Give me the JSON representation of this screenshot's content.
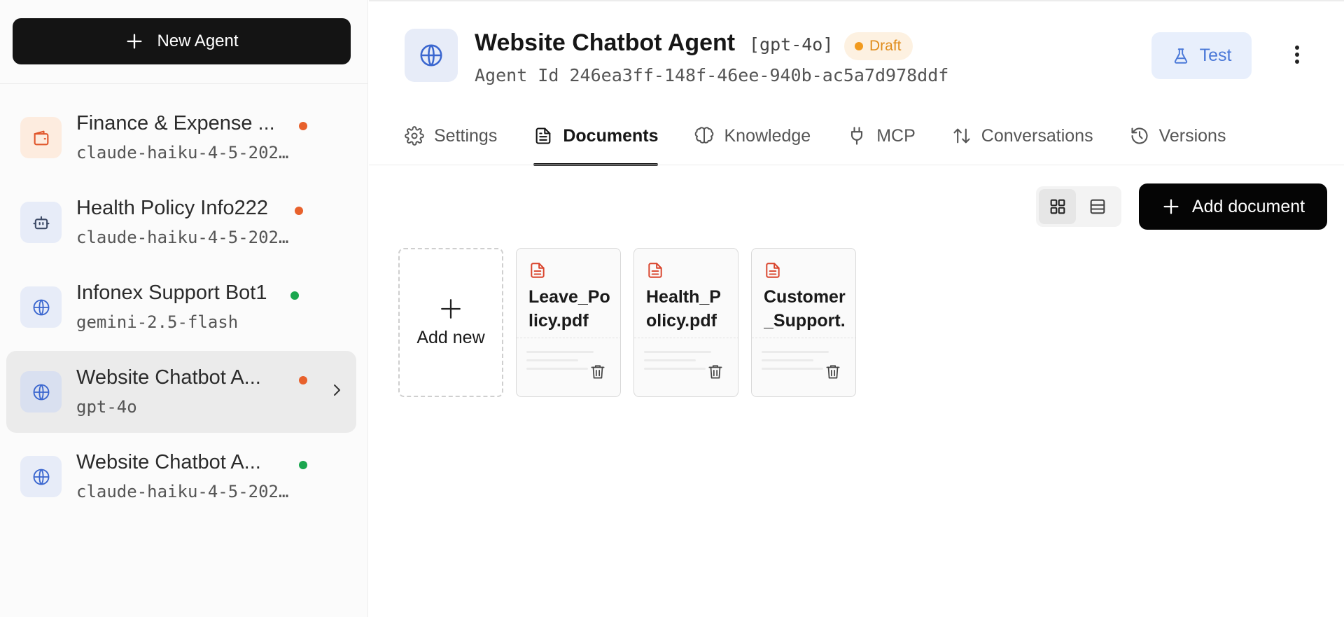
{
  "sidebar": {
    "new_agent_label": "New Agent",
    "agents": [
      {
        "name": "Finance & Expense ...",
        "model": "claude-haiku-4-5-202…",
        "status_color": "#e8612c",
        "icon": "wallet-icon"
      },
      {
        "name": "Health Policy Info222",
        "model": "claude-haiku-4-5-202…",
        "status_color": "#e8612c",
        "icon": "bot-icon"
      },
      {
        "name": "Infonex Support Bot1",
        "model": "gemini-2.5-flash",
        "status_color": "#1aa64e",
        "icon": "globe-icon"
      },
      {
        "name": "Website Chatbot A...",
        "model": "gpt-4o",
        "status_color": "#e8612c",
        "icon": "globe-icon",
        "selected": true
      },
      {
        "name": "Website Chatbot A...",
        "model": "claude-haiku-4-5-202…",
        "status_color": "#1aa64e",
        "icon": "globe-icon"
      }
    ]
  },
  "header": {
    "title": "Website Chatbot Agent",
    "model_tag": "[gpt-4o]",
    "status_badge": "Draft",
    "agent_id_label": "Agent Id",
    "agent_id": "246ea3ff-148f-46ee-940b-ac5a7d978ddf",
    "test_label": "Test"
  },
  "tabs": [
    {
      "label": "Settings",
      "icon": "gear-icon"
    },
    {
      "label": "Documents",
      "icon": "document-icon",
      "active": true
    },
    {
      "label": "Knowledge",
      "icon": "brain-icon"
    },
    {
      "label": "MCP",
      "icon": "plug-icon"
    },
    {
      "label": "Conversations",
      "icon": "arrows-updown-icon"
    },
    {
      "label": "Versions",
      "icon": "history-icon"
    }
  ],
  "documents": {
    "add_document_label": "Add document",
    "add_new_label": "Add new",
    "files": [
      {
        "name": "Leave_Policy.pdf"
      },
      {
        "name": "Health_Policy.pdf"
      },
      {
        "name": "Customer_Support.pdf"
      }
    ]
  },
  "colors": {
    "accent_blue": "#4a78d8",
    "draft_orange": "#f19a1e",
    "pdf_red": "#d9432b",
    "status_green": "#1aa64e",
    "status_orange": "#e8612c"
  }
}
